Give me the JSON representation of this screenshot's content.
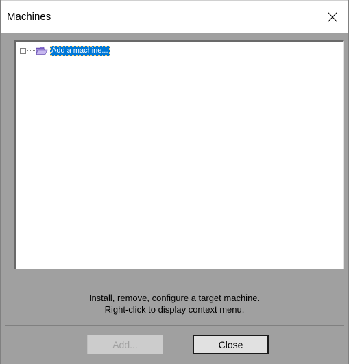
{
  "window": {
    "title": "Machines"
  },
  "tree": {
    "items": [
      {
        "label": "Add a machine...",
        "expander": "plus-box-icon",
        "icon": "folder-icon",
        "selected": true
      }
    ]
  },
  "hint": {
    "line1": "Install, remove, configure a target machine.",
    "line2": "Right-click to display context menu."
  },
  "buttons": {
    "add_label": "Add...",
    "add_enabled": false,
    "close_label": "Close"
  },
  "colors": {
    "selection": "#0078d7",
    "dialog_bg": "#a0a0a0",
    "titlebar_bg": "#ffffff"
  }
}
